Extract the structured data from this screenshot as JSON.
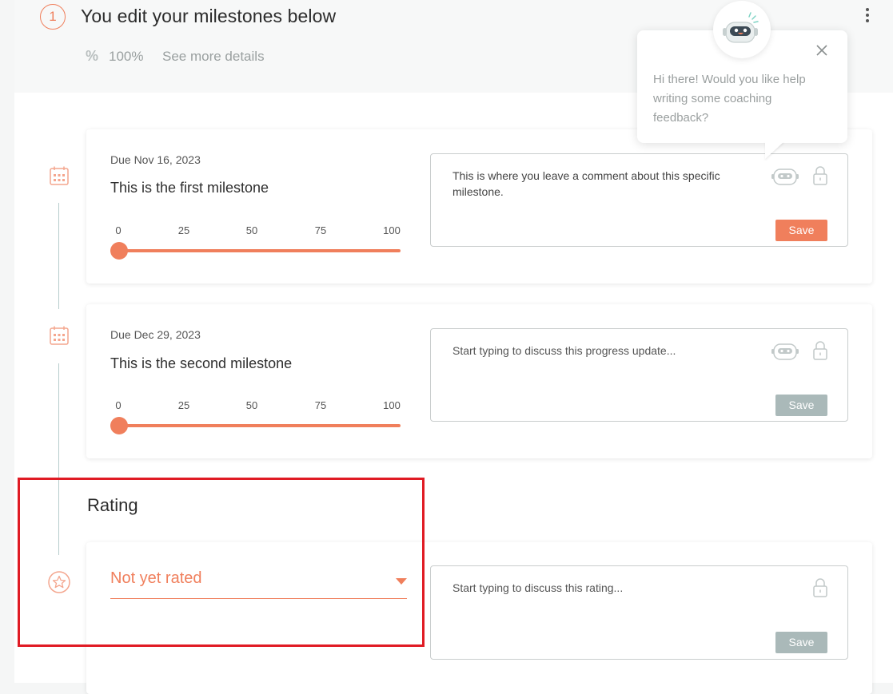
{
  "header": {
    "step_number": "1",
    "title": "You edit your milestones below",
    "progress_icon": "%",
    "progress": "100%",
    "details_link": "See more details"
  },
  "milestones": [
    {
      "due": "Due Nov 16, 2023",
      "title": "This is the first milestone",
      "ticks": [
        "0",
        "25",
        "50",
        "75",
        "100"
      ],
      "progress_value": 0,
      "comment": "This is where you leave a comment about this specific milestone.",
      "save_label": "Save",
      "save_state": "active"
    },
    {
      "due": "Due Dec 29, 2023",
      "title": "This is the second milestone",
      "ticks": [
        "0",
        "25",
        "50",
        "75",
        "100"
      ],
      "progress_value": 0,
      "comment_placeholder": "Start typing to discuss this progress update...",
      "save_label": "Save",
      "save_state": "disabled"
    }
  ],
  "rating": {
    "heading": "Rating",
    "selected": "Not yet rated",
    "comment_placeholder": "Start typing to discuss this rating...",
    "save_label": "Save"
  },
  "coach_bubble": {
    "message": "Hi there! Would you like help writing some coaching feedback?"
  },
  "colors": {
    "accent": "#f07f5c",
    "disabled_button": "#aab9b9",
    "highlight": "#e01b24",
    "timeline": "#b7cccc"
  },
  "icons": {
    "milestone": "calendar-icon",
    "rating": "star-icon",
    "assistant": "robot-icon",
    "privacy": "lock-icon",
    "close": "close-icon",
    "menu": "kebab-menu-icon"
  }
}
